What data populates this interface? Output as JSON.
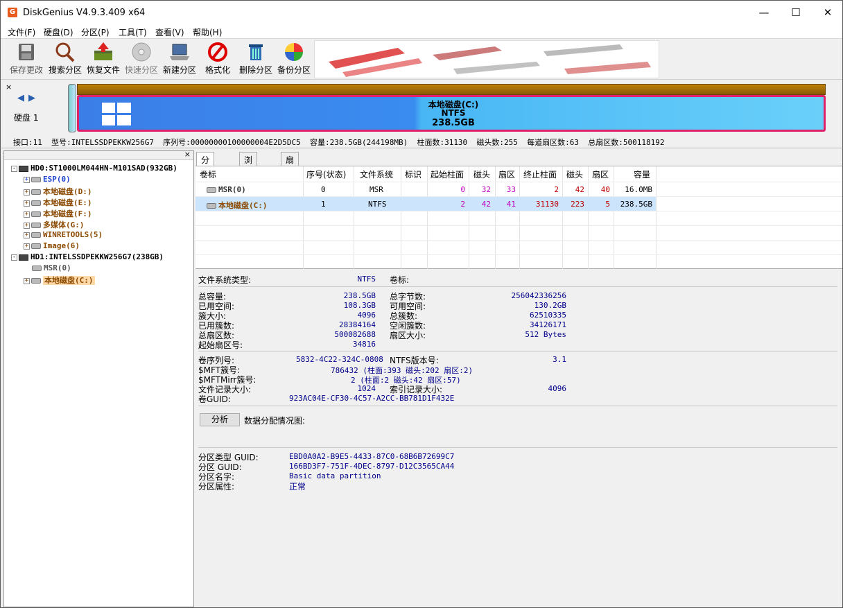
{
  "app": {
    "title": "DiskGenius V4.9.3.409 x64",
    "icon_letter": "G"
  },
  "menu": [
    "文件(F)",
    "硬盘(D)",
    "分区(P)",
    "工具(T)",
    "查看(V)",
    "帮助(H)"
  ],
  "toolbar": [
    "保存更改",
    "搜索分区",
    "恢复文件",
    "快速分区",
    "新建分区",
    "格式化",
    "删除分区",
    "备份分区"
  ],
  "diskmap": {
    "nav_label": "硬盘 1",
    "partition_name": "本地磁盘(C:)",
    "fs": "NTFS",
    "size": "238.5GB"
  },
  "diskinfo": "接口:11  型号:INTELSSDPEKKW256G7  序列号:00000000100000004E2D5DC5  容量:238.5GB(244198MB)  柱面数:31130  磁头数:255  每道扇区数:63  总扇区数:500118192",
  "tree": {
    "hd0": "HD0:ST1000LM044HN-M101SAD(932GB)",
    "hd0_parts": [
      "ESP(0)",
      "本地磁盘(D:)",
      "本地磁盘(E:)",
      "本地磁盘(F:)",
      "多媒体(G:)",
      "WINRETOOLS(5)",
      "Image(6)"
    ],
    "hd1": "HD1:INTELSSDPEKKW256G7(238GB)",
    "hd1_parts": [
      "MSR(0)",
      "本地磁盘(C:)"
    ]
  },
  "tabs": [
    "分区参数",
    "浏览文件",
    "扇区编辑"
  ],
  "table": {
    "headers": [
      "卷标",
      "序号(状态)",
      "文件系统",
      "标识",
      "起始柱面",
      "磁头",
      "扇区",
      "终止柱面",
      "磁头",
      "扇区",
      "容量"
    ],
    "rows": [
      {
        "name": "MSR(0)",
        "index": "0",
        "fs": "MSR",
        "id": "",
        "sc": "0",
        "sh": "32",
        "ss": "33",
        "ec": "2",
        "eh": "42",
        "es": "40",
        "cap": "16.0MB"
      },
      {
        "name": "本地磁盘(C:)",
        "index": "1",
        "fs": "NTFS",
        "id": "",
        "sc": "2",
        "sh": "42",
        "ss": "41",
        "ec": "31130",
        "eh": "223",
        "es": "5",
        "cap": "238.5GB"
      }
    ]
  },
  "fsinfo": {
    "fstype_label": "文件系统类型:",
    "fstype": "NTFS",
    "vol_label": "卷标:",
    "left": [
      [
        "总容量:",
        "238.5GB"
      ],
      [
        "已用空间:",
        "108.3GB"
      ],
      [
        "簇大小:",
        "4096"
      ],
      [
        "已用簇数:",
        "28384164"
      ],
      [
        "总扇区数:",
        "500082688"
      ],
      [
        "起始扇区号:",
        "34816"
      ]
    ],
    "right": [
      [
        "总字节数:",
        "256042336256"
      ],
      [
        "可用空间:",
        "130.2GB"
      ],
      [
        "总簇数:",
        "62510335"
      ],
      [
        "空闲簇数:",
        "34126171"
      ],
      [
        "扇区大小:",
        "512 Bytes"
      ]
    ],
    "vol_serial_label": "卷序列号:",
    "vol_serial": "5832-4C22-324C-0808",
    "ntfs_ver_label": "NTFS版本号:",
    "ntfs_ver": "3.1",
    "mft_label": "$MFT簇号:",
    "mft": "786432 (柱面:393 磁头:202 扇区:2)",
    "mftmirr_label": "$MFTMirr簇号:",
    "mftmirr": "2 (柱面:2 磁头:42 扇区:57)",
    "rec_label": "文件记录大小:",
    "rec": "1024",
    "idx_label": "索引记录大小:",
    "idx": "4096",
    "guid_label": "卷GUID:",
    "guid": "923AC04E-CF30-4C57-A2CC-BB781D1F432E",
    "analyze_btn": "分析",
    "alloc_label": "数据分配情况图:",
    "ptype_label": "分区类型 GUID:",
    "ptype": "EBD0A0A2-B9E5-4433-87C0-68B6B72699C7",
    "pguid_label": "分区 GUID:",
    "pguid": "166BD3F7-751F-4DEC-8797-D12C3565CA44",
    "pname_label": "分区名字:",
    "pname": "Basic data partition",
    "pattr_label": "分区属性:",
    "pattr": "正常"
  }
}
